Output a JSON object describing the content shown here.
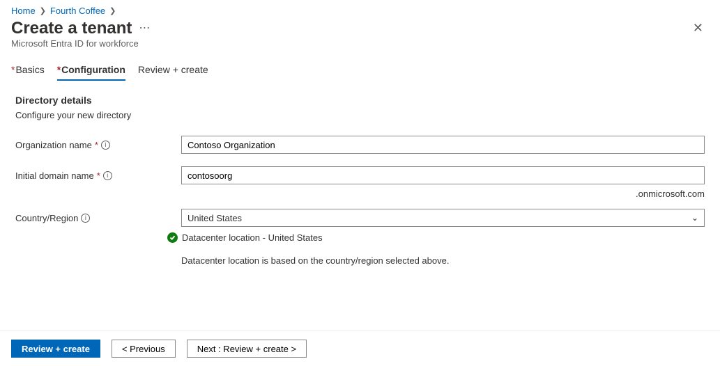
{
  "breadcrumb": {
    "home": "Home",
    "org": "Fourth Coffee"
  },
  "header": {
    "title": "Create a tenant",
    "subtitle": "Microsoft Entra ID for workforce"
  },
  "tabs": {
    "basics": "Basics",
    "configuration": "Configuration",
    "review": "Review + create"
  },
  "section": {
    "heading": "Directory details",
    "desc": "Configure your new directory"
  },
  "fields": {
    "org_label": "Organization name",
    "org_value": "Contoso Organization",
    "domain_label": "Initial domain name",
    "domain_value": "contosoorg",
    "domain_suffix": ".onmicrosoft.com",
    "region_label": "Country/Region",
    "region_value": "United States"
  },
  "datacenter": {
    "location": "Datacenter location - United States",
    "note": "Datacenter location is based on the country/region selected above."
  },
  "footer": {
    "review": "Review + create",
    "previous": "< Previous",
    "next": "Next : Review + create >"
  }
}
